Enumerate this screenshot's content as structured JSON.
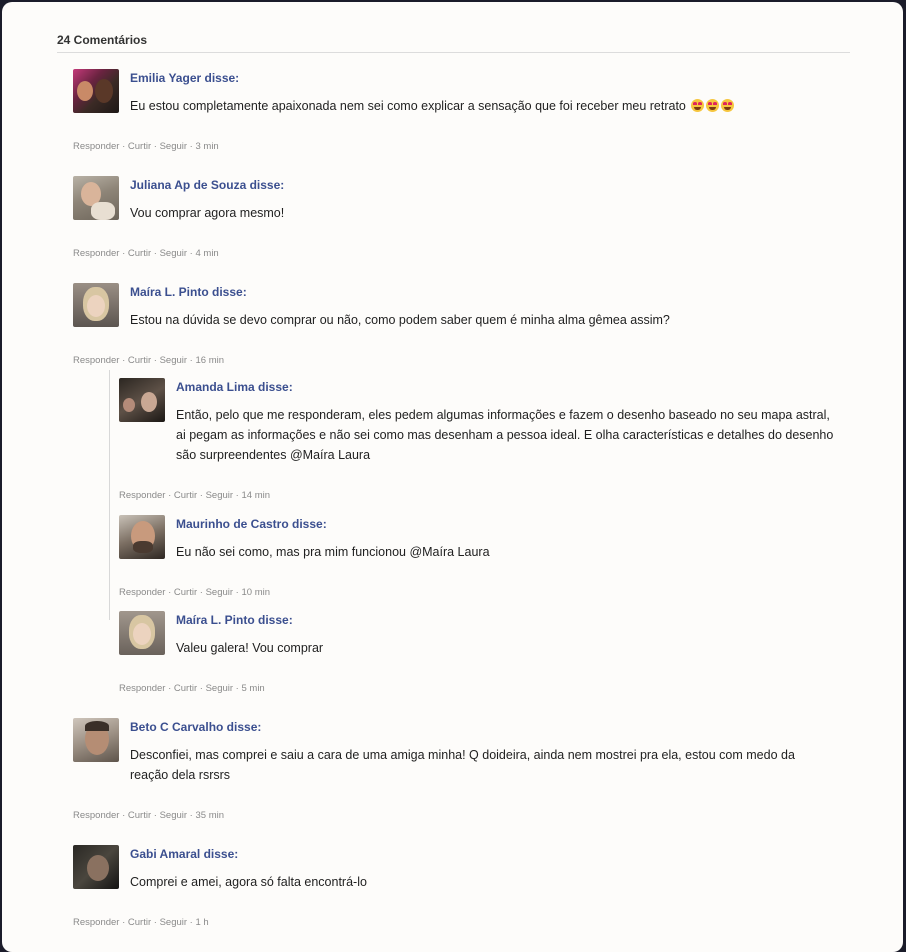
{
  "header": {
    "count_label": "24 Comentários"
  },
  "comments": [
    {
      "author": "Emilia Yager disse:",
      "text": "Eu estou completamente apaixonada nem sei como explicar a sensação que foi receber meu retrato",
      "emojis": [
        "heart-eyes-emoji",
        "heart-eyes-emoji",
        "heart-eyes-emoji"
      ],
      "meta": "Responder · Curtir · Seguir · 3 min"
    },
    {
      "author": "Juliana Ap de Souza disse:",
      "text": "Vou comprar agora mesmo!",
      "meta": "Responder · Curtir · Seguir · 4 min"
    },
    {
      "author": "Maíra L. Pinto disse:",
      "text": "Estou na dúvida se devo comprar ou não, como podem saber quem é minha alma gêmea assim?",
      "meta": "Responder · Curtir · Seguir · 16 min"
    },
    {
      "author": "Amanda Lima disse:",
      "text": "Então, pelo que me responderam, eles pedem algumas informações e fazem o desenho baseado no seu mapa astral, ai pegam as informações e não sei como mas desenham a pessoa ideal. E olha características e detalhes do desenho são surpreendentes @Maíra Laura",
      "meta": "Responder · Curtir · Seguir · 14 min"
    },
    {
      "author": "Maurinho de Castro disse:",
      "text": "Eu não sei como, mas pra mim funcionou @Maíra Laura",
      "meta": "Responder · Curtir · Seguir · 10 min"
    },
    {
      "author": "Maíra L. Pinto disse:",
      "text": "Valeu galera! Vou comprar",
      "meta": "Responder · Curtir · Seguir · 5 min"
    },
    {
      "author": "Beto C Carvalho disse:",
      "text": "Desconfiei, mas comprei e saiu a cara de uma amiga minha! Q doideira, ainda nem mostrei pra ela, estou com medo da reação dela rsrsrs",
      "meta": "Responder · Curtir · Seguir · 35 min"
    },
    {
      "author": "Gabi Amaral disse:",
      "text": "Comprei e amei, agora só falta encontrá-lo",
      "meta": "Responder · Curtir · Seguir · 1 h"
    }
  ]
}
